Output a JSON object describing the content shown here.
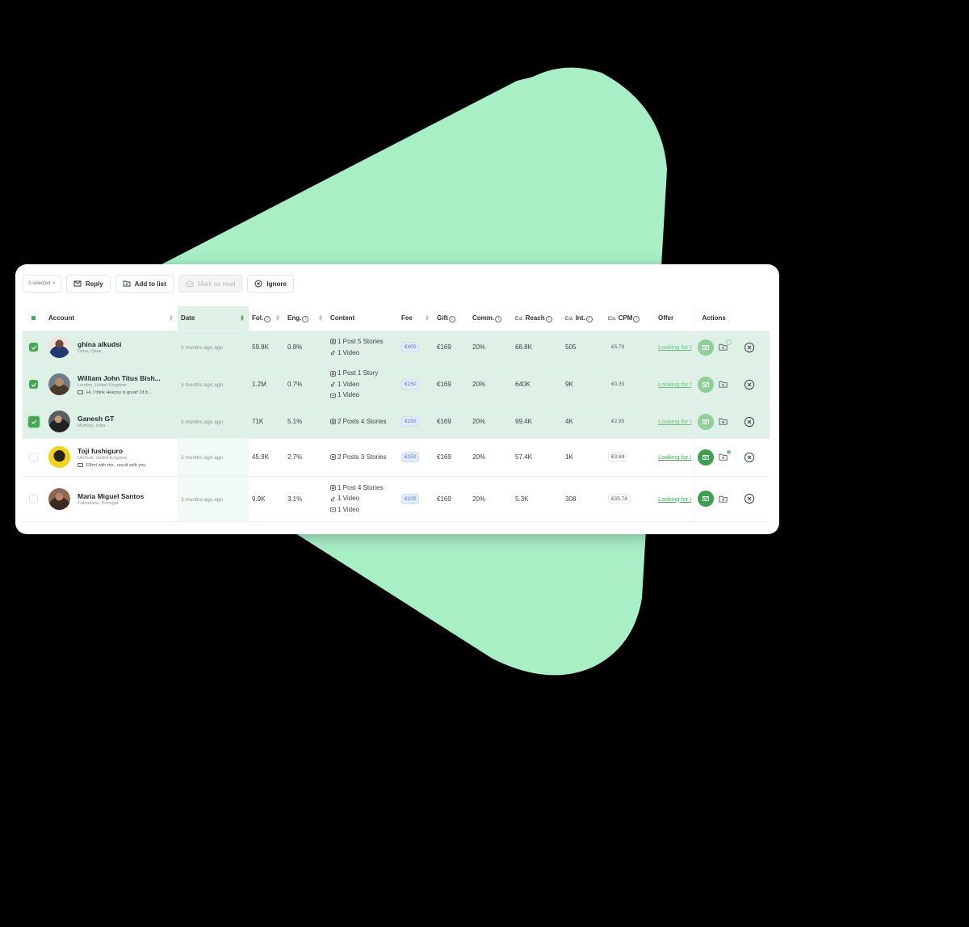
{
  "toolbar": {
    "selected_chip": "3 selected",
    "selected_chip_close": "×",
    "reply": "Reply",
    "add_to_list": "Add to list",
    "mark_as_read": "Mark as read",
    "ignore": "Ignore"
  },
  "columns": {
    "account": "Account",
    "date": "Date",
    "followers": "Fol.",
    "engagement": "Eng.",
    "content": "Content",
    "fee": "Fee",
    "gift": "Gift",
    "commission": "Comm.",
    "est_prefix": "Est.",
    "reach": "Reach",
    "interactions": "Int.",
    "cpm": "CPM",
    "offer": "Offer",
    "actions": "Actions",
    "info_glyph": "i"
  },
  "rows": [
    {
      "selected": true,
      "name": "ghina alkudsi",
      "location": "Doha, Qatar",
      "message": "",
      "date": "3 months ago ago",
      "followers": "59.8K",
      "engagement": "0.8%",
      "content": [
        {
          "icon": "instagram-icon",
          "text": "1 Post  5 Stories"
        },
        {
          "icon": "tiktok-icon",
          "text": "1 Video"
        }
      ],
      "fee": "€400",
      "gift": "€169",
      "commission": "20%",
      "reach": "68.8K",
      "interactions": "505",
      "cpm": "€5.79",
      "offer": "Looking for I",
      "folder_badge": true
    },
    {
      "selected": true,
      "name": "William John Titus Bish...",
      "location": "London, United Kingdom",
      "message": "Hi, I think Heepsy is great! I'd b...",
      "date": "3 months ago ago",
      "followers": "1.2M",
      "engagement": "0.7%",
      "content": [
        {
          "icon": "instagram-icon",
          "text": "1 Post  1 Story"
        },
        {
          "icon": "tiktok-icon",
          "text": "1 Video"
        },
        {
          "icon": "youtube-icon",
          "text": "1 Video"
        }
      ],
      "fee": "€150",
      "gift": "€169",
      "commission": "20%",
      "reach": "640K",
      "interactions": "9K",
      "cpm": "€0.35",
      "offer": "Looking for I",
      "folder_badge": false
    },
    {
      "selected": true,
      "name": "Ganesh GT",
      "location": "Mumbai, India",
      "message": "",
      "date": "3 months ago ago",
      "followers": "71K",
      "engagement": "5.1%",
      "content": [
        {
          "icon": "instagram-icon",
          "text": "2 Posts  4 Stories"
        }
      ],
      "fee": "€250",
      "gift": "€169",
      "commission": "20%",
      "reach": "99.4K",
      "interactions": "4K",
      "cpm": "€2.95",
      "offer": "Looking for I",
      "folder_badge": false
    },
    {
      "selected": false,
      "name": "Toji fushiguro",
      "location": "Northolt, United Kingdom",
      "message": "Effort with me , result with you",
      "date": "3 months ago ago",
      "followers": "45.9K",
      "engagement": "2.7%",
      "content": [
        {
          "icon": "instagram-icon",
          "text": "2 Posts  3 Stories"
        }
      ],
      "fee": "€150",
      "gift": "€169",
      "commission": "20%",
      "reach": "57.4K",
      "interactions": "1K",
      "cpm": "€3.89",
      "offer": "Looking for I",
      "folder_badge": true
    },
    {
      "selected": false,
      "name": "Maria Miguel Santos",
      "location": "Calendario, Portugal",
      "message": "",
      "date": "3 months ago ago",
      "followers": "9.9K",
      "engagement": "3.1%",
      "content": [
        {
          "icon": "instagram-icon",
          "text": "1 Post  4 Stories"
        },
        {
          "icon": "tiktok-icon",
          "text": "1 Video"
        },
        {
          "icon": "youtube-icon",
          "text": "1 Video"
        }
      ],
      "fee": "€100",
      "gift": "€169",
      "commission": "20%",
      "reach": "5.3K",
      "interactions": "308",
      "cpm": "€35.74",
      "offer": "Looking for I",
      "folder_badge": false
    }
  ],
  "colors": {
    "accent_green": "#45a752",
    "selected_row": "#dff0e6",
    "background_shape": "#a8efc6",
    "fee_badge_text": "#4a76d6"
  }
}
